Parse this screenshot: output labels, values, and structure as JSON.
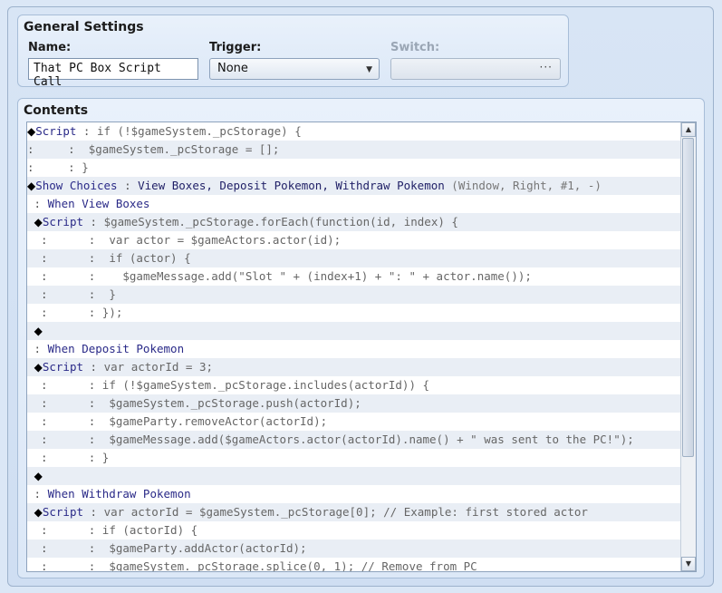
{
  "general": {
    "title": "General Settings",
    "name_label": "Name:",
    "name_value": "That PC Box Script Call",
    "trigger_label": "Trigger:",
    "trigger_value": "None",
    "switch_label": "Switch:",
    "switch_button": "···"
  },
  "contents": {
    "title": "Contents",
    "rows": [
      [
        {
          "t": "◆",
          "c": "diamond"
        },
        {
          "t": "Script",
          "c": "cmd"
        },
        {
          "t": " : ",
          "c": "sep"
        },
        {
          "t": "if (!$gameSystem._pcStorage) {",
          "c": "code"
        }
      ],
      [
        {
          "t": ":     :  ",
          "c": "sep"
        },
        {
          "t": "$gameSystem._pcStorage = [];",
          "c": "code"
        }
      ],
      [
        {
          "t": ":     : ",
          "c": "sep"
        },
        {
          "t": "}",
          "c": "code"
        }
      ],
      [
        {
          "t": "◆",
          "c": "diamond"
        },
        {
          "t": "Show Choices",
          "c": "cmd"
        },
        {
          "t": " : ",
          "c": "sep"
        },
        {
          "t": "View Boxes, Deposit Pokemon, Withdraw Pokemon",
          "c": "arg"
        },
        {
          "t": " (Window, Right, #1, -)",
          "c": "dim"
        }
      ],
      [
        {
          "t": " : ",
          "c": "sep"
        },
        {
          "t": "When View Boxes",
          "c": "branch"
        }
      ],
      [
        {
          "t": "  ◆",
          "c": "diamond"
        },
        {
          "t": "Script",
          "c": "cmd"
        },
        {
          "t": " : ",
          "c": "sep"
        },
        {
          "t": "$gameSystem._pcStorage.forEach(function(id, index) {",
          "c": "code"
        }
      ],
      [
        {
          "t": "  :      :  ",
          "c": "sep"
        },
        {
          "t": "var actor = $gameActors.actor(id);",
          "c": "code"
        }
      ],
      [
        {
          "t": "  :      :  ",
          "c": "sep"
        },
        {
          "t": "if (actor) {",
          "c": "code"
        }
      ],
      [
        {
          "t": "  :      :  ",
          "c": "sep"
        },
        {
          "t": "  $gameMessage.add(\"Slot \" + (index+1) + \": \" + actor.name());",
          "c": "code"
        }
      ],
      [
        {
          "t": "  :      :  ",
          "c": "sep"
        },
        {
          "t": "}",
          "c": "code"
        }
      ],
      [
        {
          "t": "  :      : ",
          "c": "sep"
        },
        {
          "t": "});",
          "c": "code"
        }
      ],
      [
        {
          "t": "  ◆",
          "c": "diamond"
        }
      ],
      [
        {
          "t": " : ",
          "c": "sep"
        },
        {
          "t": "When Deposit Pokemon",
          "c": "branch"
        }
      ],
      [
        {
          "t": "  ◆",
          "c": "diamond"
        },
        {
          "t": "Script",
          "c": "cmd"
        },
        {
          "t": " : ",
          "c": "sep"
        },
        {
          "t": "var actorId = 3;",
          "c": "code"
        }
      ],
      [
        {
          "t": "  :      : ",
          "c": "sep"
        },
        {
          "t": "if (!$gameSystem._pcStorage.includes(actorId)) {",
          "c": "code"
        }
      ],
      [
        {
          "t": "  :      :  ",
          "c": "sep"
        },
        {
          "t": "$gameSystem._pcStorage.push(actorId);",
          "c": "code"
        }
      ],
      [
        {
          "t": "  :      :  ",
          "c": "sep"
        },
        {
          "t": "$gameParty.removeActor(actorId);",
          "c": "code"
        }
      ],
      [
        {
          "t": "  :      :  ",
          "c": "sep"
        },
        {
          "t": "$gameMessage.add($gameActors.actor(actorId).name() + \" was sent to the PC!\");",
          "c": "code"
        }
      ],
      [
        {
          "t": "  :      : ",
          "c": "sep"
        },
        {
          "t": "}",
          "c": "code"
        }
      ],
      [
        {
          "t": "  ◆",
          "c": "diamond"
        }
      ],
      [
        {
          "t": " : ",
          "c": "sep"
        },
        {
          "t": "When Withdraw Pokemon",
          "c": "branch"
        }
      ],
      [
        {
          "t": "  ◆",
          "c": "diamond"
        },
        {
          "t": "Script",
          "c": "cmd"
        },
        {
          "t": " : ",
          "c": "sep"
        },
        {
          "t": "var actorId = $gameSystem._pcStorage[0]; // Example: first stored actor",
          "c": "code"
        }
      ],
      [
        {
          "t": "  :      : ",
          "c": "sep"
        },
        {
          "t": "if (actorId) {",
          "c": "code"
        }
      ],
      [
        {
          "t": "  :      :  ",
          "c": "sep"
        },
        {
          "t": "$gameParty.addActor(actorId);",
          "c": "code"
        }
      ],
      [
        {
          "t": "  :      :  ",
          "c": "sep"
        },
        {
          "t": "$gameSystem._pcStorage.splice(0, 1); // Remove from PC",
          "c": "code"
        }
      ]
    ]
  },
  "scrollbar": {
    "up_icon": "▲",
    "down_icon": "▼"
  }
}
